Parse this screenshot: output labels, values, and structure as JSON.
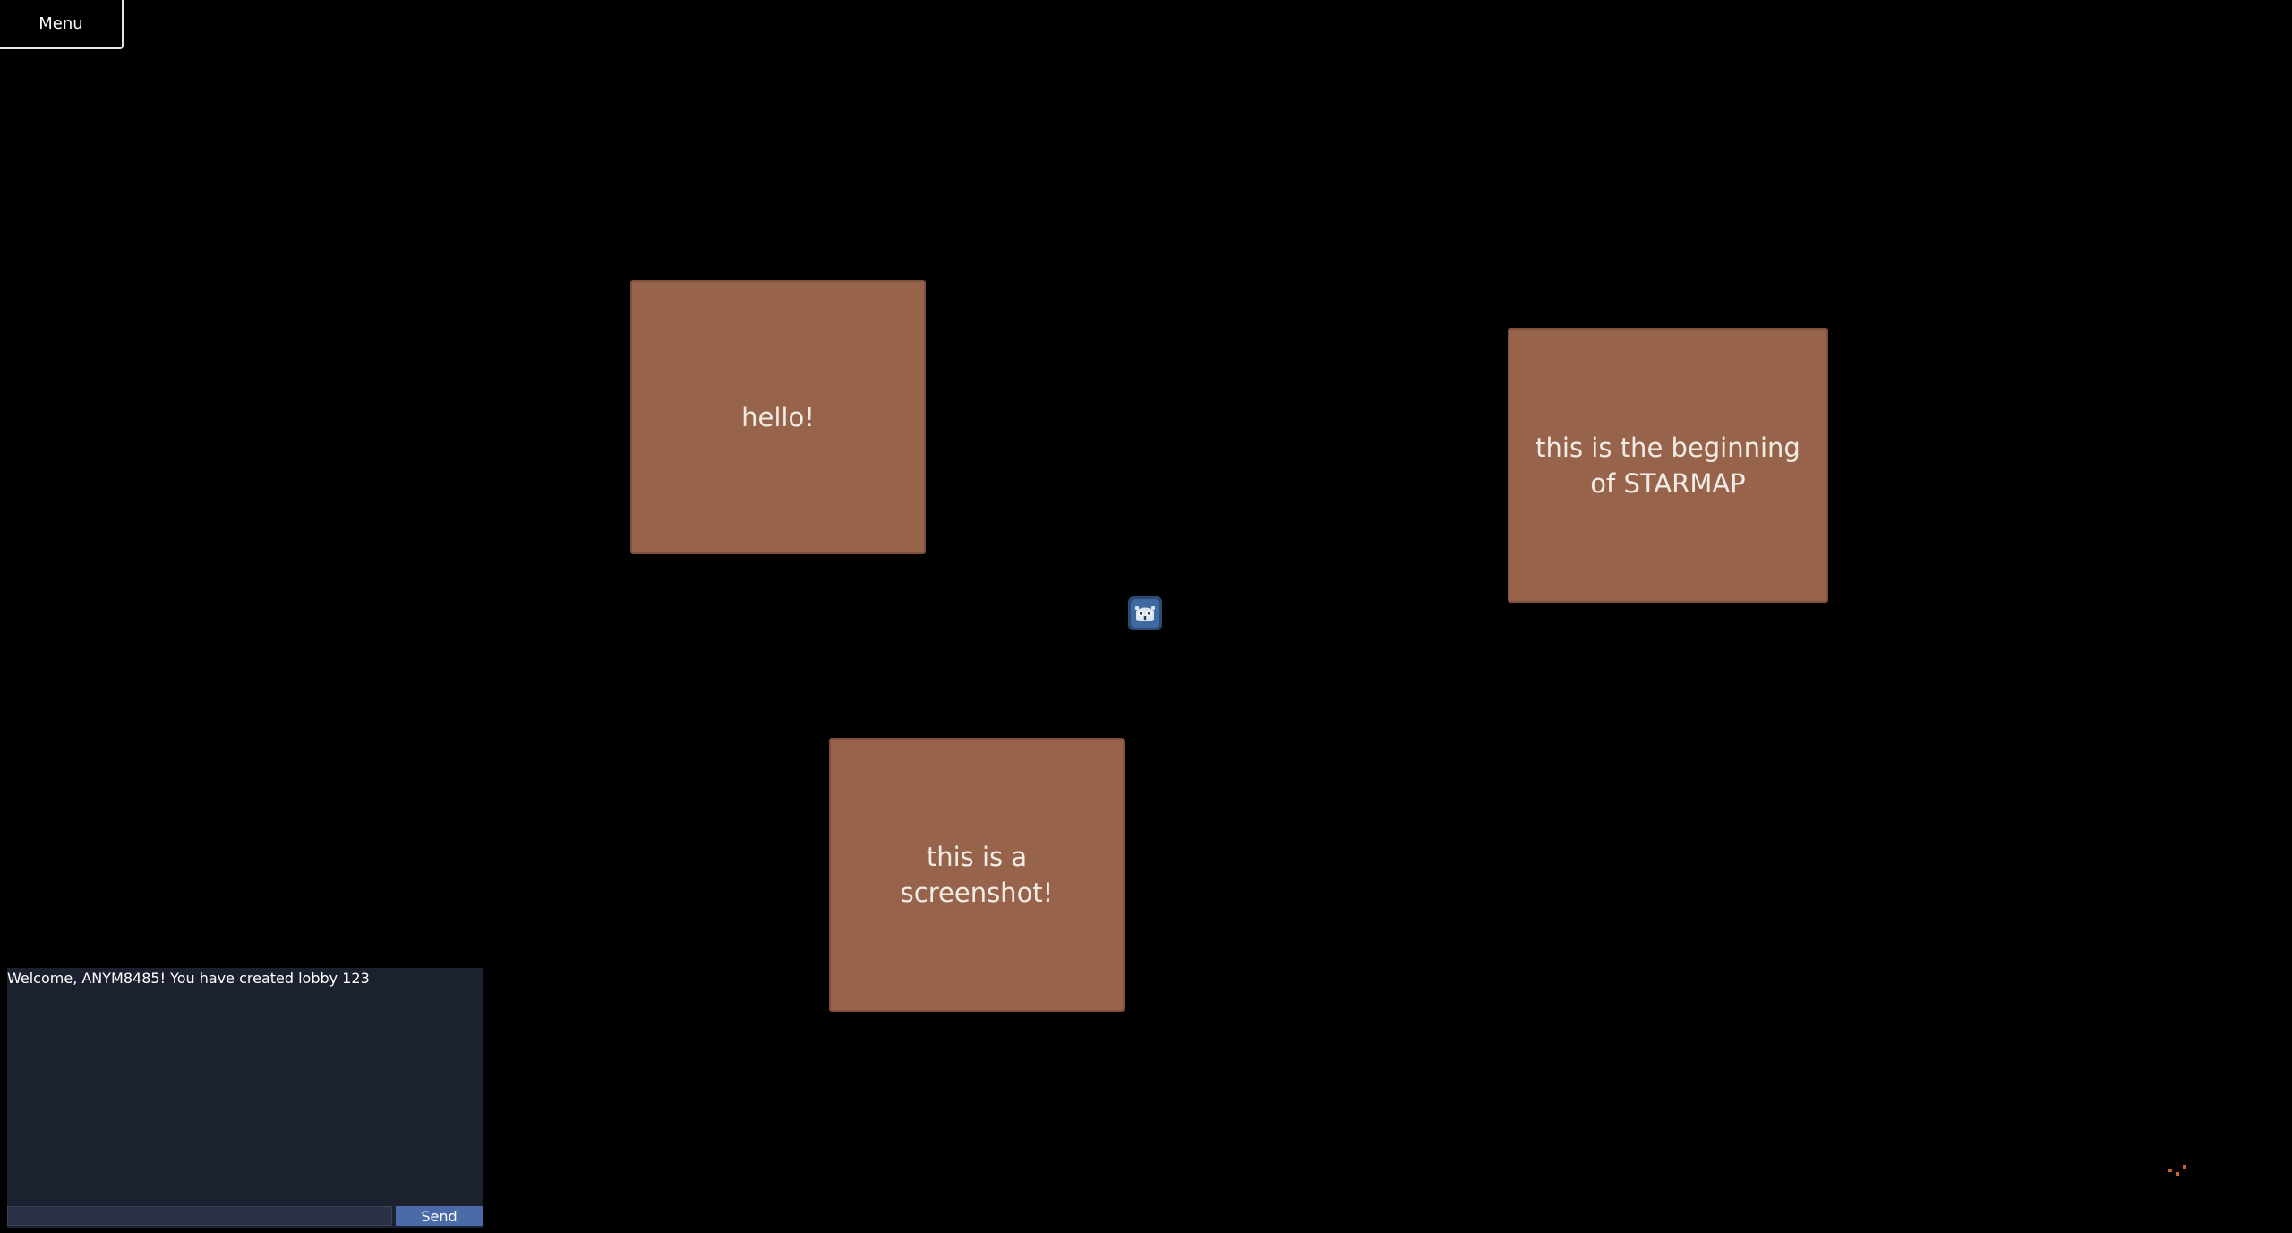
{
  "menu": {
    "label": "Menu"
  },
  "cards": [
    {
      "text": "hello!"
    },
    {
      "text": "this is the beginning of STARMAP"
    },
    {
      "text": "this is a screenshot!"
    }
  ],
  "player": {
    "icon": "godot-robot-icon"
  },
  "chat": {
    "messages": [
      "Welcome, ANYM8485! You have created lobby 123"
    ],
    "input_value": "",
    "input_placeholder": "",
    "send_label": "Send"
  },
  "colors": {
    "background": "#000000",
    "card_fill": "#97644b",
    "card_border": "#7f513d",
    "chat_panel": "#1c2130",
    "send_button": "#4a6aa8",
    "grip": "#c8652a"
  }
}
